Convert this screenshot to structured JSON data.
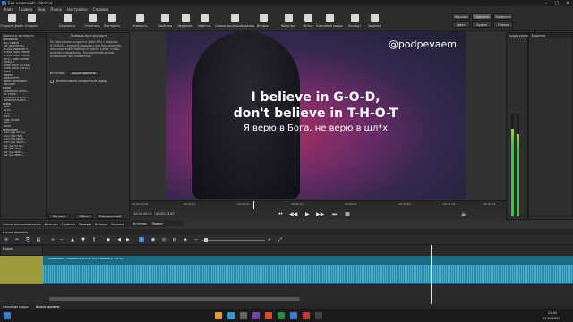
{
  "window": {
    "title": "Без названия* - Shotcut",
    "controls": [
      "–",
      "□",
      "✕"
    ]
  },
  "menu": [
    "Файл",
    "Правка",
    "Вид",
    "Поиск",
    "Настройки",
    "Справка"
  ],
  "toolbar": {
    "buttons": [
      {
        "label": "Открыть файл",
        "icon": "folder-open-icon"
      },
      {
        "label": "Открыть",
        "icon": "open-other-icon"
      },
      {
        "label": "Сохранить",
        "icon": "save-icon"
      },
      {
        "label": "Отменить",
        "icon": "undo-icon"
      },
      {
        "label": "Повторить",
        "icon": "redo-icon"
      },
      {
        "label": "Измерить",
        "icon": "peak-meter-icon"
      },
      {
        "label": "Свойства",
        "icon": "properties-icon"
      },
      {
        "label": "Недавние",
        "icon": "recent-icon"
      },
      {
        "label": "Заметки",
        "icon": "notes-icon"
      },
      {
        "label": "Список воспроизведения",
        "icon": "playlist-icon"
      },
      {
        "label": "История",
        "icon": "history-icon"
      },
      {
        "label": "Фильтры",
        "icon": "filters-icon"
      },
      {
        "label": "Метки",
        "icon": "markers-icon"
      },
      {
        "label": "Ключевые кадры",
        "icon": "keyframes-icon"
      },
      {
        "label": "Экспорт",
        "icon": "export-icon"
      },
      {
        "label": "Задания",
        "icon": "jobs-icon"
      }
    ],
    "layouts": {
      "row1": [
        "Журнал",
        "Нарезка",
        "Эффекты"
      ],
      "row2": [
        "Цвет",
        "Аудио",
        "Плеер"
      ],
      "active": "Нарезка"
    }
  },
  "export_panel": {
    "title": "Пресеты экспорта",
    "groups": [
      {
        "name": "Основные",
        "items": [
          "AV1 WebM",
          "GIF Animation",
          "H.264 Baseline P...",
          "H.264 High Profile",
          "H.264 Main Profile",
          "HEVC Main Profile",
          "MPEG-2",
          "Slide Deck (H.264)",
          "Slide Deck (HEVC)",
          "WMV",
          "WebM",
          "WebM VP9",
          "WebP Animation",
          "YouTube"
        ]
      },
      {
        "name": "alpha",
        "items": [
          "Quicktime Anim...",
          "Ut Video",
          "WebM VP8 with ...",
          "WebM VP9 with ..."
        ]
      },
      {
        "name": "audio",
        "items": [
          "AAC",
          "ALAC",
          "FLAC",
          "MP3",
          "Ogg Vorbis",
          "WAV",
          "WMA"
        ]
      },
      {
        "name": "camcorder",
        "items": [
          "D10 (SD NTSC)",
          "D10 (SD PAL)",
          "D10 (SD Wide...",
          "D10 (SD Wide...",
          "DV (SD NTSC)",
          "DV (SD PAL)",
          "DV (SD Wide...",
          "DV (SD Wide..."
        ]
      }
    ],
    "help_title": "Помощь при экспорте",
    "help_text": "По умолчанию создается файл MP4 с кодеком H.264/AAC, который подходит для большинства пользователей. Выберите пресет слева, чтобы изменить параметры. Расширенный режим отображает все параметры.",
    "source_label": "Источник:",
    "source_value": "Шкала времени",
    "hw_label": "Использовать аппаратный кодер",
    "bottom_buttons": [
      "Экспорт",
      "Сброс",
      "Расширенный"
    ]
  },
  "left_tabs": [
    "Список воспроизведения",
    "Фильтры",
    "Свойства",
    "Экспорт",
    "История",
    "Задания"
  ],
  "video": {
    "handle": "@podpevaem",
    "line1": "I believe in G-O-D,",
    "line2": "don't believe in T-H-O-T",
    "line3": "Я верю в Бога, не верю в шл*х"
  },
  "ruler_ticks": [
    "00:00:00;00",
    "00:00:10",
    "00:00:20",
    "00:00:30",
    "00:00:40",
    "00:00:50",
    "00:01:00",
    "00:01:10"
  ],
  "transport": {
    "timecode": "00:00:45;03",
    "duration": "/ 00:01:12;27",
    "source_tab": "Источник",
    "project_tab": "Проект"
  },
  "timeline": {
    "title": "Шкала времени",
    "output_label": "Вывод",
    "track_v": "V1",
    "track_a": "A1",
    "clip_name": "Podpevaem - I believe in G-O-D, don't believe in T-H-O-T",
    "bottom_tabs": [
      "Ключевые кадры",
      "Шкала времени"
    ]
  },
  "meter": {
    "label": "Аудиоуровень",
    "ticks": [
      "0",
      "-5",
      "-10",
      "-15",
      "-20",
      "-25",
      "-30",
      "-35",
      "-40",
      "-50"
    ]
  },
  "right_panel": {
    "title": "Задания",
    "columns": "Задания"
  },
  "clock": {
    "time": "21:40",
    "date": "21.10.2022"
  },
  "colors": {
    "accent": "#3a7bd5",
    "clip": "#1b6b85",
    "wave": "#4fb1d0",
    "meter_green": "#2ecc40"
  }
}
